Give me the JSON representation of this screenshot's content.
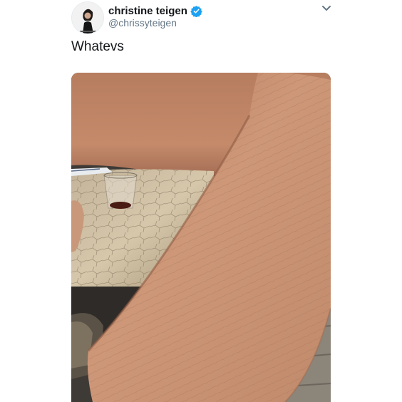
{
  "tweet": {
    "display_name": "christine teigen",
    "handle": "@chrissyteigen",
    "text": "Whatevs"
  },
  "icons": {
    "verified": "verified-badge-icon",
    "menu": "chevron-down-icon"
  },
  "colors": {
    "name": "#14171a",
    "handle": "#657786",
    "verified": "#1da1f2",
    "caret": "#657786"
  }
}
